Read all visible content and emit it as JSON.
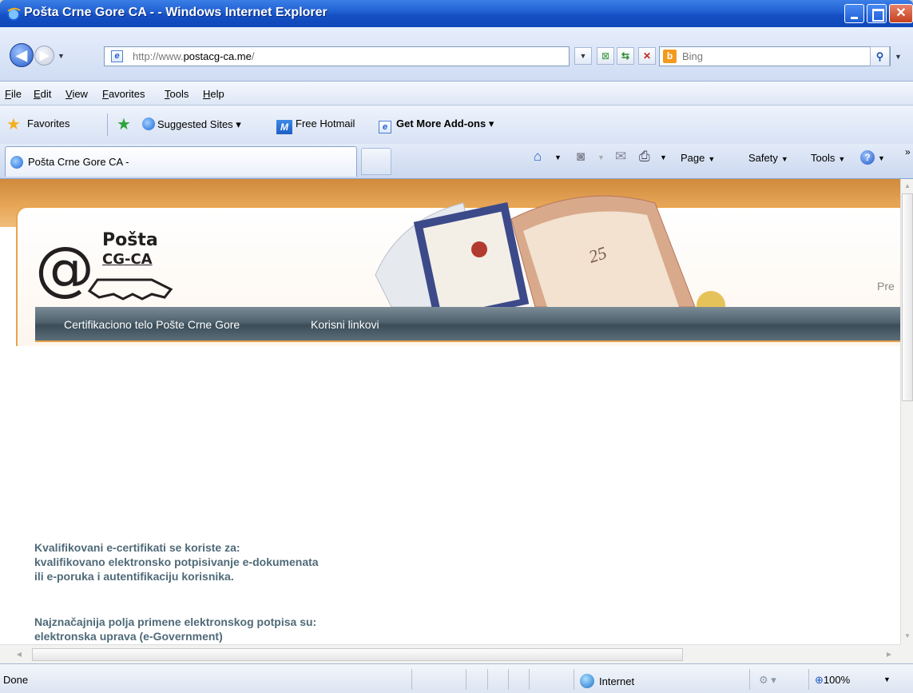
{
  "window": {
    "title": "Pošta Crne Gore CA - - Windows Internet Explorer"
  },
  "address_bar": {
    "url_prefix": "http://www.",
    "url_domain": "postacg-ca.me",
    "url_suffix": "/",
    "search_placeholder": "Bing"
  },
  "menu": [
    "File",
    "Edit",
    "View",
    "Favorites",
    "Tools",
    "Help"
  ],
  "favorites_bar": {
    "favorites_label": "Favorites",
    "suggested_sites": "Suggested Sites",
    "free_hotmail": "Free Hotmail",
    "get_addons": "Get More Add-ons"
  },
  "tab": {
    "label": "Pošta Crne Gore CA -"
  },
  "command_bar": {
    "page": "Page",
    "safety": "Safety",
    "tools": "Tools"
  },
  "page": {
    "logo_line1": "Pošta",
    "logo_line2": "CG-CA",
    "header_right_partial": "Pre",
    "nav": [
      "Certifikaciono telo Pošte Crne Gore",
      "Korisni linkovi"
    ],
    "paragraph1": [
      "Kvalifikovani e-certifikati se koriste za:",
      "kvalifikovano elektronsko potpisivanje e-dokumenata",
      "ili e-poruka i autentifikaciju korisnika."
    ],
    "paragraph2": [
      "Najznačajnija polja primene elektronskog potpisa su:",
      "elektronska uprava (e-Government)"
    ]
  },
  "status_bar": {
    "status": "Done",
    "zone": "Internet",
    "zoom": "100%"
  },
  "colors": {
    "titlebar": "#1f5fd1",
    "orange_band": "#e8a85a",
    "nav_strip": "#4f626d",
    "body_text": "#4f6a78"
  }
}
